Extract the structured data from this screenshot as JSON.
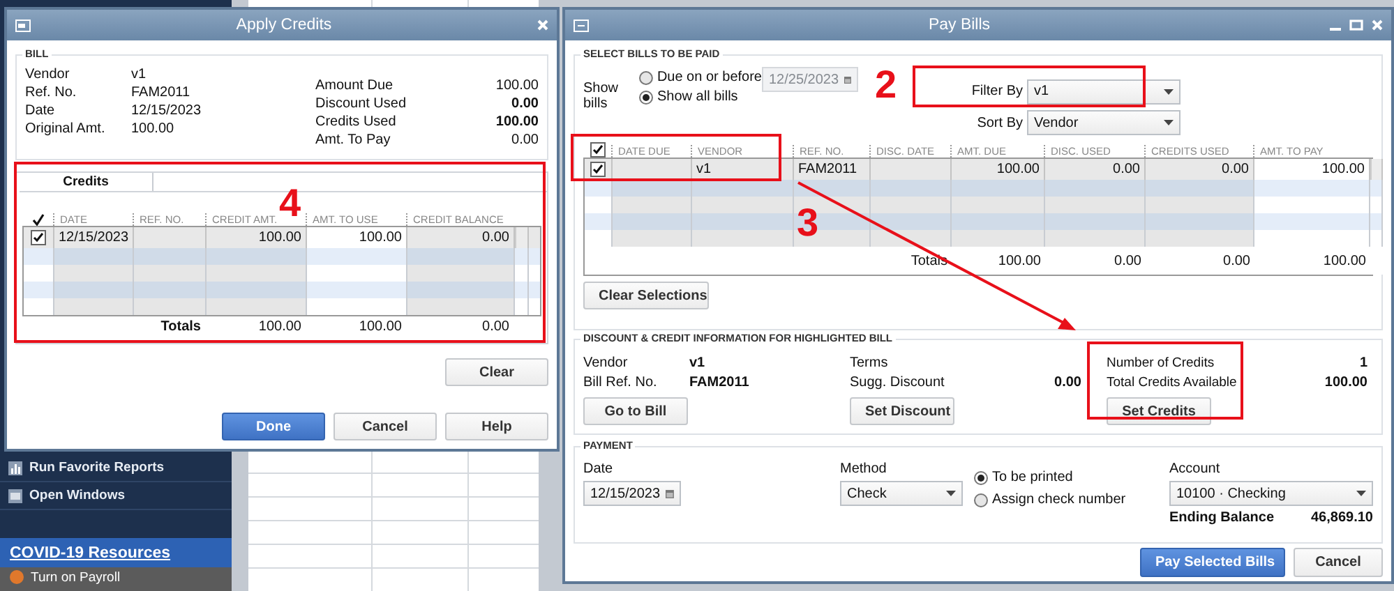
{
  "background": {
    "sidebar": [
      {
        "label": "Run Favorite Reports",
        "kind": "reports"
      },
      {
        "label": "Open Windows",
        "kind": "windows"
      }
    ],
    "covid_link": "COVID-19 Resources",
    "payroll": "Turn on Payroll"
  },
  "apply_credits": {
    "title": "Apply Credits",
    "bill": {
      "legend": "BILL",
      "left": [
        {
          "label": "Vendor",
          "value": "v1"
        },
        {
          "label": "Ref. No.",
          "value": "FAM2011"
        },
        {
          "label": "Date",
          "value": "12/15/2023"
        },
        {
          "label": "Original Amt.",
          "value": "100.00"
        }
      ],
      "right": [
        {
          "label": "Amount Due",
          "value": "100.00",
          "bold": false
        },
        {
          "label": "Discount Used",
          "value": "0.00",
          "bold": true
        },
        {
          "label": "Credits Used",
          "value": "100.00",
          "bold": true
        },
        {
          "label": "Amt. To Pay",
          "value": "0.00",
          "bold": false
        }
      ]
    },
    "tabs": [
      {
        "label": "Credits",
        "selected": true
      }
    ],
    "columns": [
      "DATE",
      "REF. NO.",
      "CREDIT AMT.",
      "AMT. TO USE",
      "CREDIT BALANCE"
    ],
    "rows": [
      {
        "checked": true,
        "date": "12/15/2023",
        "credit_amt": "100.00",
        "amt_to_use": "100.00",
        "credit_balance": "0.00"
      }
    ],
    "totals": {
      "label": "Totals",
      "credit_amt": "100.00",
      "amt_to_use": "100.00",
      "credit_balance": "0.00"
    },
    "clear_button": "Clear",
    "buttons": [
      {
        "label": "Done",
        "kind": "primary"
      },
      {
        "label": "Cancel",
        "kind": "normal"
      },
      {
        "label": "Help",
        "kind": "normal"
      }
    ]
  },
  "pay_bills": {
    "title": "Pay Bills",
    "select_legend": "SELECT BILLS TO BE PAID",
    "show_bills_label": "Show bills",
    "show_options": [
      {
        "label": "Due on or before",
        "selected": false
      },
      {
        "label": "Show all bills",
        "selected": true
      }
    ],
    "due_date": {
      "value": "12/25/2023",
      "disabled": true
    },
    "filter": {
      "label": "Filter By",
      "value": "v1"
    },
    "sort": {
      "label": "Sort By",
      "value": "Vendor"
    },
    "select_all_checked": true,
    "columns": [
      "DATE DUE",
      "VENDOR",
      "REF. NO.",
      "DISC. DATE",
      "AMT. DUE",
      "DISC. USED",
      "CREDITS USED",
      "AMT. TO PAY"
    ],
    "rows": [
      {
        "checked": true,
        "vendor": "v1",
        "ref_no": "FAM2011",
        "amt_due": "100.00",
        "disc_used": "0.00",
        "credits_used": "0.00",
        "amt_to_pay": "100.00"
      }
    ],
    "totals": {
      "label": "Totals",
      "amt_due": "100.00",
      "disc_used": "0.00",
      "credits_used": "0.00",
      "amt_to_pay": "100.00"
    },
    "clear_button": "Clear Selections",
    "discount": {
      "legend": "DISCOUNT & CREDIT INFORMATION FOR HIGHLIGHTED BILL",
      "vendor_label": "Vendor",
      "vendor": "v1",
      "ref_label": "Bill Ref. No.",
      "ref": "FAM2011",
      "goto_button": "Go to Bill",
      "terms_label": "Terms",
      "sugg_label": "Sugg. Discount",
      "sugg_value": "0.00",
      "set_discount_button": "Set Discount",
      "num_credits_label": "Number of Credits",
      "num_credits": "1",
      "total_credits_label": "Total Credits Available",
      "total_credits": "100.00",
      "set_credits_button": "Set Credits"
    },
    "payment": {
      "legend": "PAYMENT",
      "date_label": "Date",
      "date": "12/15/2023",
      "method_label": "Method",
      "method": "Check",
      "print_options": [
        {
          "label": "To be printed",
          "selected": true
        },
        {
          "label": "Assign check number",
          "selected": false
        }
      ],
      "account_label": "Account",
      "account": "10100 · Checking",
      "ending_label": "Ending Balance",
      "ending_balance": "46,869.10"
    },
    "buttons": [
      {
        "label": "Pay Selected Bills",
        "kind": "primary"
      },
      {
        "label": "Cancel",
        "kind": "normal"
      }
    ]
  },
  "annotations": [
    {
      "label": "4"
    },
    {
      "label": "2"
    },
    {
      "label": "3"
    }
  ]
}
